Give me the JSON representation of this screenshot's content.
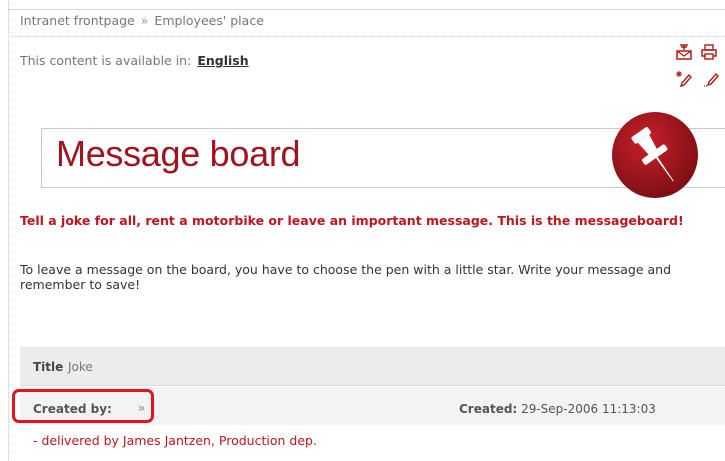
{
  "breadcrumb": {
    "root": "Intranet frontpage",
    "separator": "»",
    "current": "Employees' place"
  },
  "language": {
    "prefix": "This content is available in:",
    "link": "English"
  },
  "icons": [
    "send-to-friend-icon",
    "print-icon",
    "new-message-pen-icon",
    "edit-pen-icon"
  ],
  "board": {
    "title": "Message board"
  },
  "intro": "Tell a joke for all, rent a motorbike or leave an important message. This is the messageboard!",
  "instructions": "To leave a message on the board, you have to choose the pen with a little star. Write your message and remember to save!",
  "post": {
    "title_label": "Title",
    "title_value": "Joke",
    "created_by_label": "Created by:",
    "created_by_arrow": "»",
    "created_label": "Created:",
    "created_value": "29-Sep-2006 11:13:03",
    "body": "- delivered by James Jantzen, Production dep."
  },
  "colors": {
    "accent": "#c0141e",
    "title": "#a0141e",
    "highlight": "#e0141e"
  }
}
